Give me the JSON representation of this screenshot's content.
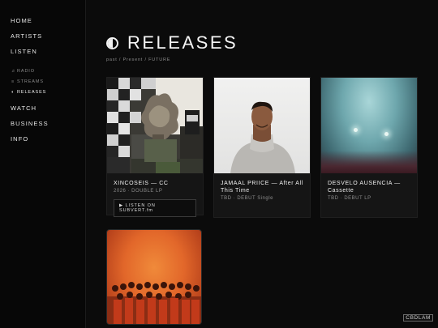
{
  "sidebar": {
    "nav": {
      "home": "HOME",
      "artists": "ARTISTS",
      "listen": "LISTEN",
      "radio": "RADIO",
      "streams": "STREAMS",
      "releases": "RELEASES",
      "watch": "WATCH",
      "business": "BUSINESS",
      "info": "INFO"
    },
    "glyphs": {
      "radio": "♬",
      "streams": "≡",
      "releases": "◐"
    }
  },
  "main": {
    "title": "RELEASES",
    "crumbs": "past / Present / FUTURE",
    "cards": [
      {
        "name": "XINCOSEIS — CC",
        "sub": "2026 · DOUBLE LP",
        "button": "▶ LISTEN ON SUBVERT.fm"
      },
      {
        "name": "JAMAAL PRIICE — After All This Time",
        "sub": "TBD · DEBUT Single"
      },
      {
        "name": "DESVELO AUSENCIA — Cassette",
        "sub": "TBD · DEBUT LP"
      },
      {
        "name": "",
        "sub": ""
      }
    ]
  },
  "watermark": "CBDLAM",
  "colors": {
    "background": "#0b0b0b",
    "card": "#151515",
    "text": "#e8e8e8",
    "muted": "#8c8c8c"
  }
}
